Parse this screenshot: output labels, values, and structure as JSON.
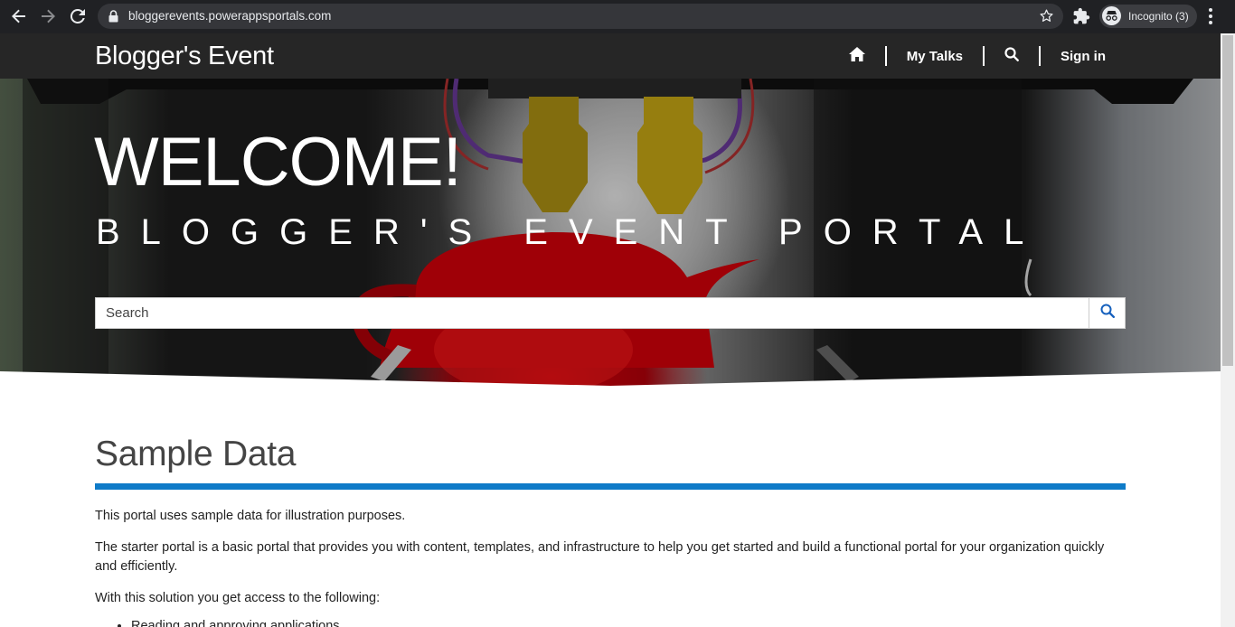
{
  "browser": {
    "url": "bloggerevents.powerappsportals.com",
    "incognito_label": "Incognito (3)",
    "icons": [
      "back-icon",
      "forward-icon",
      "reload-icon",
      "lock-icon",
      "star-icon",
      "extensions-icon",
      "incognito-icon",
      "menu-icon"
    ]
  },
  "site": {
    "brand": "Blogger's Event",
    "nav": {
      "home_icon": "home-icon",
      "my_talks": "My Talks",
      "search_icon": "search-icon",
      "sign_in": "Sign in"
    }
  },
  "hero": {
    "welcome": "WELCOME!",
    "subtitle": "BLOGGER'S EVENT PORTAL",
    "search_placeholder": "Search"
  },
  "main": {
    "title": "Sample Data",
    "paragraphs": [
      "This portal uses sample data for illustration purposes.",
      "The starter portal is a basic portal that provides you with content, templates, and infrastructure to help you get started and build a functional portal for your organization quickly and efficiently.",
      "With this solution you get access to the following:"
    ],
    "list_items": [
      "Reading and approving applications"
    ]
  },
  "colors": {
    "nav_bg": "#262626",
    "accent": "#0f7bc8",
    "chrome_bg": "#202124"
  }
}
